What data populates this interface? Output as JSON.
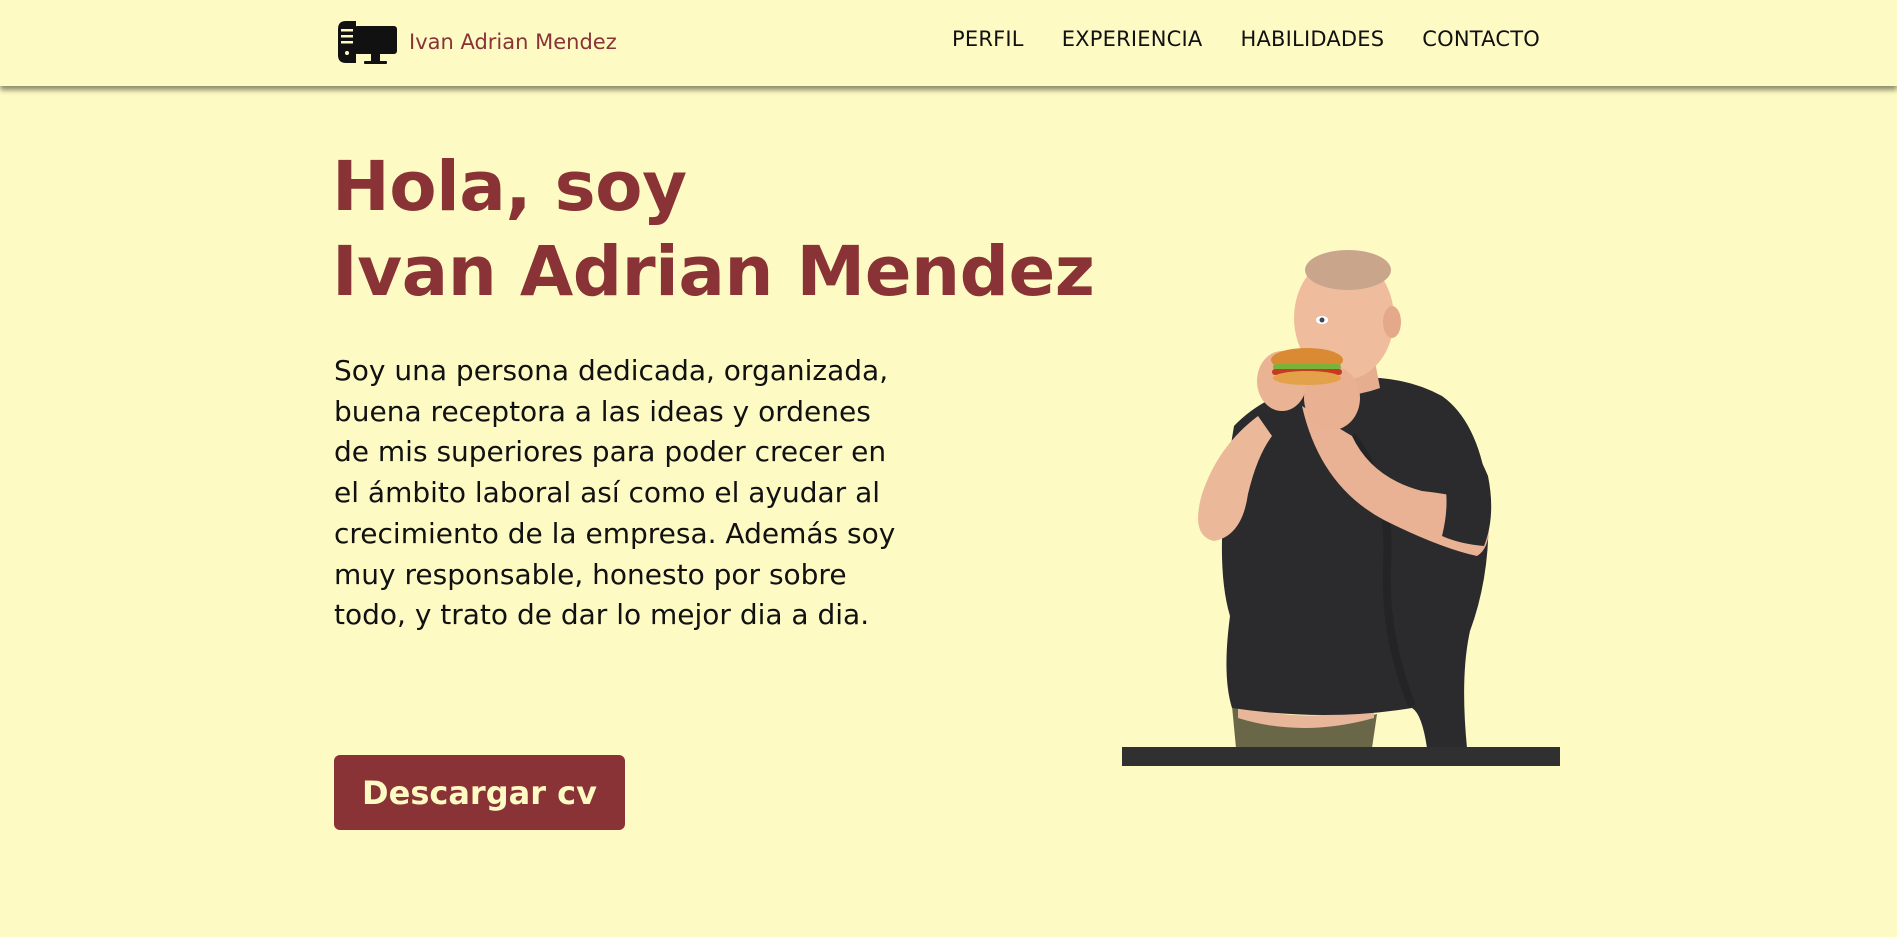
{
  "header": {
    "brand_name": "Ivan Adrian Mendez",
    "brand_icon": "computer-icon",
    "nav": [
      {
        "label": "PERFIL"
      },
      {
        "label": "EXPERIENCIA"
      },
      {
        "label": "HABILIDADES"
      },
      {
        "label": "CONTACTO"
      }
    ]
  },
  "hero": {
    "title_line1": "Hola, soy",
    "title_line2": "Ivan Adrian Mendez",
    "description": "Soy una persona dedicada, organizada, buena receptora a las ideas y ordenes de mis superiores para poder crecer en el ámbito laboral así como el ayudar al crecimiento de la empresa. Además soy muy responsable, honesto por sobre todo, y trato de dar lo mejor dia a dia.",
    "button_label": "Descargar cv"
  },
  "colors": {
    "background": "#fdfbc3",
    "accent": "#8a3337",
    "text": "#111111",
    "photo_bar": "#303030"
  }
}
